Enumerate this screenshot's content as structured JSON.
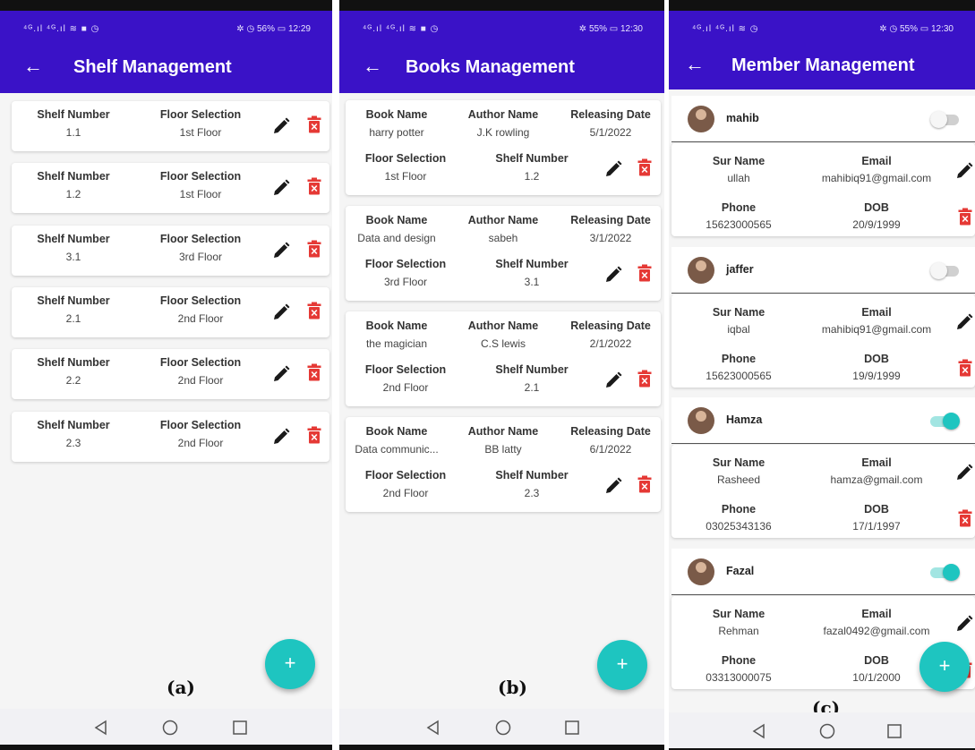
{
  "status": {
    "screen_a": {
      "left": "⁴ᴳ.ıl ⁴ᴳ.ıl ≋ ■ ◷",
      "right": "✲ ◷ 56% ▭ 12:29"
    },
    "screen_b": {
      "left": "⁴ᴳ.ıl ⁴ᴳ.ıl ≋ ■ ◷",
      "right": "✲ 55% ▭ 12:30"
    },
    "screen_c": {
      "left": "⁴ᴳ.ıl ⁴ᴳ.ıl ≋ ◷",
      "right": "✲ ◷ 55% ▭ 12:30"
    }
  },
  "screen_a": {
    "title": "Shelf Management",
    "caption": "(a)",
    "shelf_label": "Shelf Number",
    "floor_label": "Floor Selection",
    "shelves": [
      {
        "shelf": "1.1",
        "floor": "1st Floor"
      },
      {
        "shelf": "1.2",
        "floor": "1st Floor"
      },
      {
        "shelf": "3.1",
        "floor": "3rd Floor"
      },
      {
        "shelf": "2.1",
        "floor": "2nd Floor"
      },
      {
        "shelf": "2.2",
        "floor": "2nd Floor"
      },
      {
        "shelf": "2.3",
        "floor": "2nd Floor"
      }
    ]
  },
  "screen_b": {
    "title": "Books Management",
    "caption": "(b)",
    "labels": {
      "book": "Book Name",
      "author": "Author Name",
      "date": "Releasing Date",
      "floor": "Floor Selection",
      "shelf": "Shelf Number"
    },
    "books": [
      {
        "book": "harry potter",
        "author": "J.K rowling",
        "date": "5/1/2022",
        "floor": "1st Floor",
        "shelf": "1.2"
      },
      {
        "book": "Data and design",
        "author": "sabeh",
        "date": "3/1/2022",
        "floor": "3rd Floor",
        "shelf": "3.1"
      },
      {
        "book": "the magician",
        "author": "C.S lewis",
        "date": "2/1/2022",
        "floor": "2nd Floor",
        "shelf": "2.1"
      },
      {
        "book": "Data communic...",
        "author": "BB latty",
        "date": "6/1/2022",
        "floor": "2nd Floor",
        "shelf": "2.3"
      }
    ]
  },
  "screen_c": {
    "title": "Member Management",
    "caption": "(c)",
    "labels": {
      "surname": "Sur Name",
      "email": "Email",
      "phone": "Phone",
      "dob": "DOB"
    },
    "members": [
      {
        "name": "mahib",
        "active": false,
        "surname": "ullah",
        "email": "mahibiq91@gmail.com",
        "phone": "15623000565",
        "dob": "20/9/1999"
      },
      {
        "name": "jaffer",
        "active": false,
        "surname": "iqbal",
        "email": "mahibiq91@gmail.com",
        "phone": "15623000565",
        "dob": "19/9/1999"
      },
      {
        "name": "Hamza",
        "active": true,
        "surname": "Rasheed",
        "email": "hamza@gmail.com",
        "phone": "03025343136",
        "dob": "17/1/1997"
      },
      {
        "name": "Fazal",
        "active": true,
        "surname": "Rehman",
        "email": "fazal0492@gmail.com",
        "phone": "03313000075",
        "dob": "10/1/2000"
      }
    ]
  },
  "fab_symbol": "+",
  "back_symbol": "←",
  "colors": {
    "appbar": "#3a12c7",
    "fab": "#1ec5c0",
    "trash": "#e53935",
    "pencil": "#1a1a1a"
  }
}
